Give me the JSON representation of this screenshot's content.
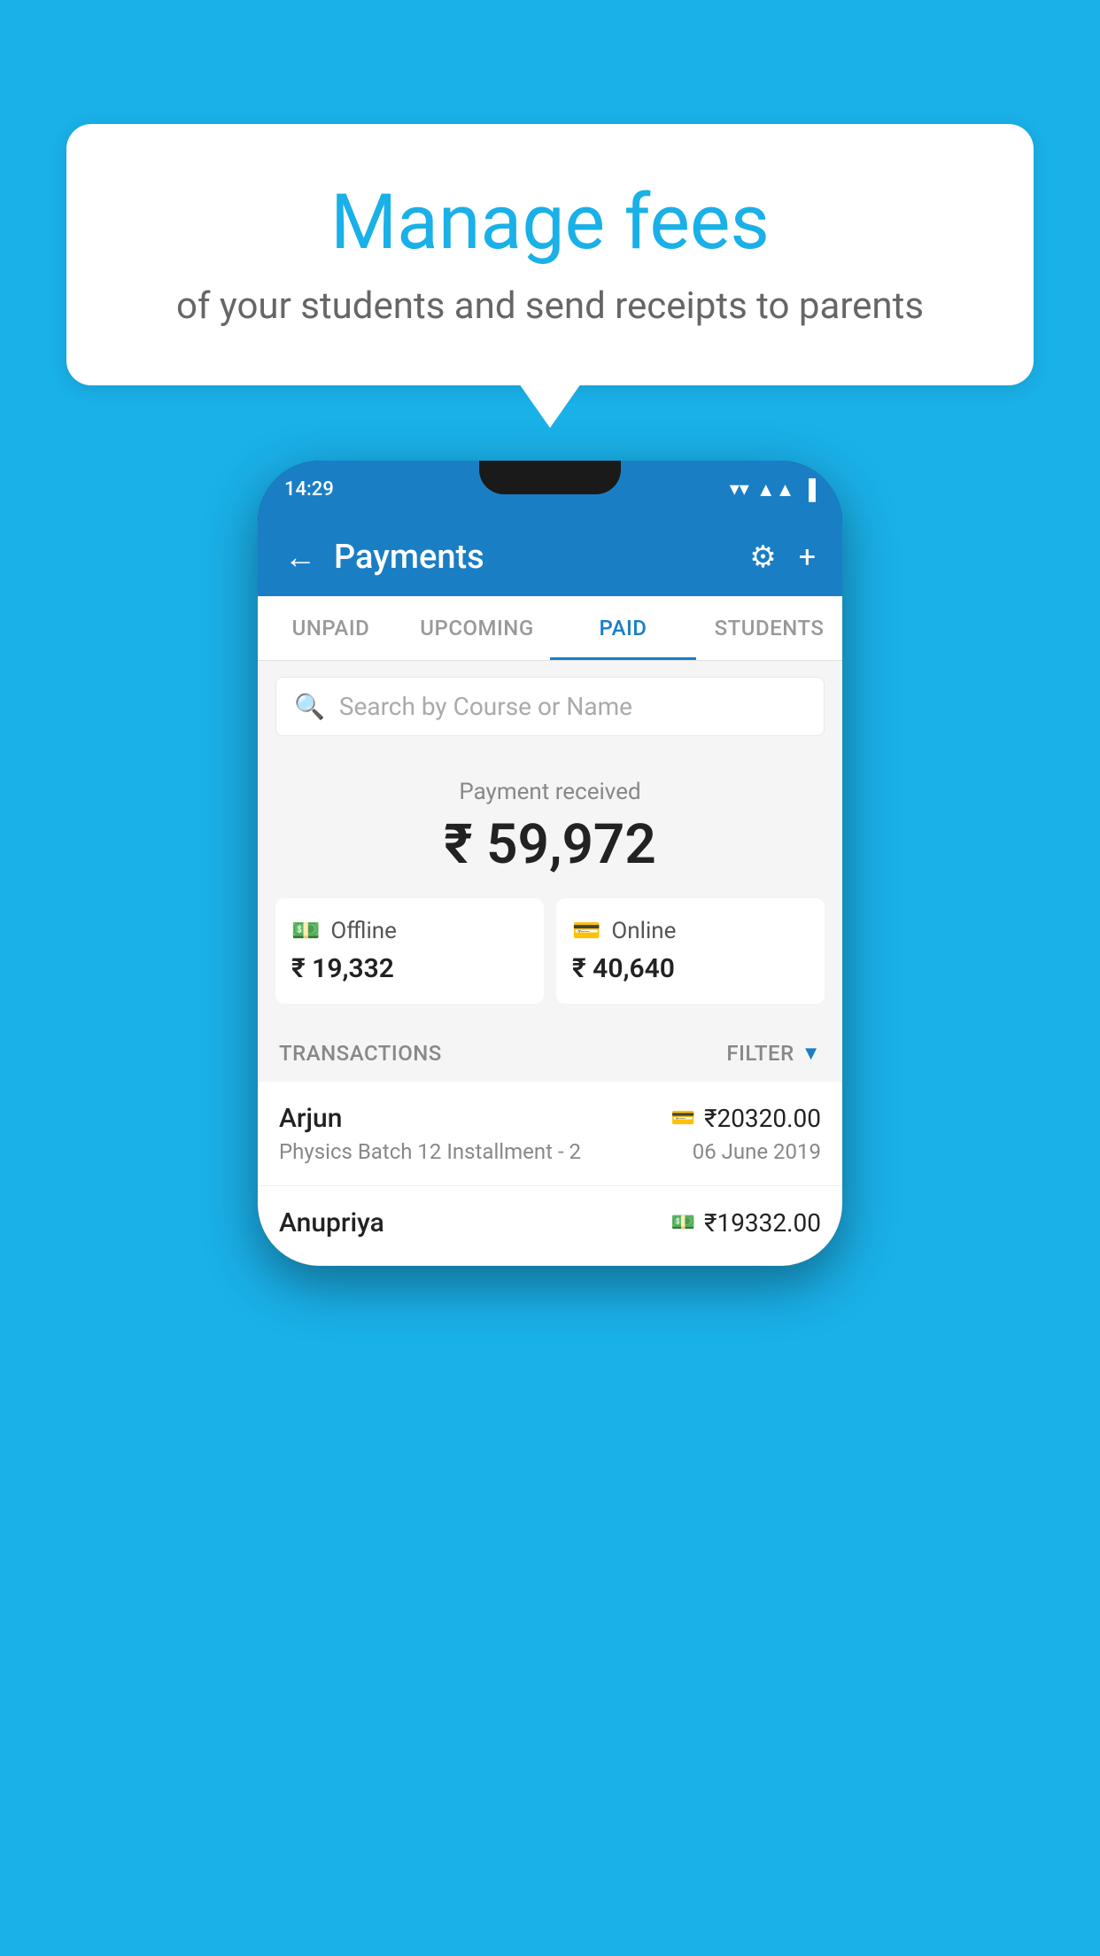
{
  "background_color": "#1ab0e8",
  "speech_bubble": {
    "title": "Manage fees",
    "subtitle": "of your students and send receipts to parents"
  },
  "status_bar": {
    "time": "14:29",
    "wifi": "▼",
    "signal": "▲",
    "battery": "▌"
  },
  "header": {
    "title": "Payments",
    "back_label": "←",
    "gear_label": "⚙",
    "plus_label": "+"
  },
  "tabs": [
    {
      "label": "UNPAID",
      "active": false
    },
    {
      "label": "UPCOMING",
      "active": false
    },
    {
      "label": "PAID",
      "active": true
    },
    {
      "label": "STUDENTS",
      "active": false
    }
  ],
  "search": {
    "placeholder": "Search by Course or Name"
  },
  "payment_summary": {
    "label": "Payment received",
    "total": "₹ 59,972",
    "offline_label": "Offline",
    "offline_amount": "₹ 19,332",
    "online_label": "Online",
    "online_amount": "₹ 40,640"
  },
  "transactions_section": {
    "label": "TRANSACTIONS",
    "filter_label": "FILTER"
  },
  "transactions": [
    {
      "name": "Arjun",
      "course": "Physics Batch 12 Installment - 2",
      "amount": "₹20320.00",
      "date": "06 June 2019",
      "mode": "card"
    },
    {
      "name": "Anupriya",
      "course": "",
      "amount": "₹19332.00",
      "date": "",
      "mode": "cash"
    }
  ]
}
